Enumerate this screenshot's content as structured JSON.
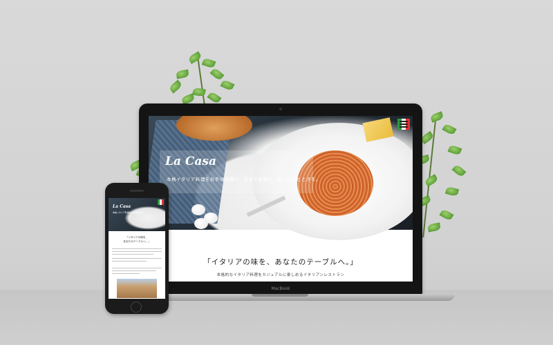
{
  "laptop": {
    "site": {
      "title": "La Casa",
      "subtitle": "本格イタリア料理をお手頃価格で。友達や家族と、楽しいひとときを。",
      "heading": "「イタリアの味を、あなたのテーブルへ。」",
      "tagline": "本格的なイタリア料理をカジュアルに楽しめるイタリアンレストラン",
      "menu_colors": [
        "#2a9a3f",
        "#ffffff",
        "#dd3333"
      ]
    },
    "brand": "MacBook"
  },
  "phone": {
    "site": {
      "title": "La Casa",
      "subtitle": "本格イタリア料理をお手頃価格で。",
      "heading_line1": "「イタリアの味を、",
      "heading_line2": "あなたのテーブルへ。」"
    }
  },
  "icons": [
    "hamburger-menu-icon"
  ]
}
